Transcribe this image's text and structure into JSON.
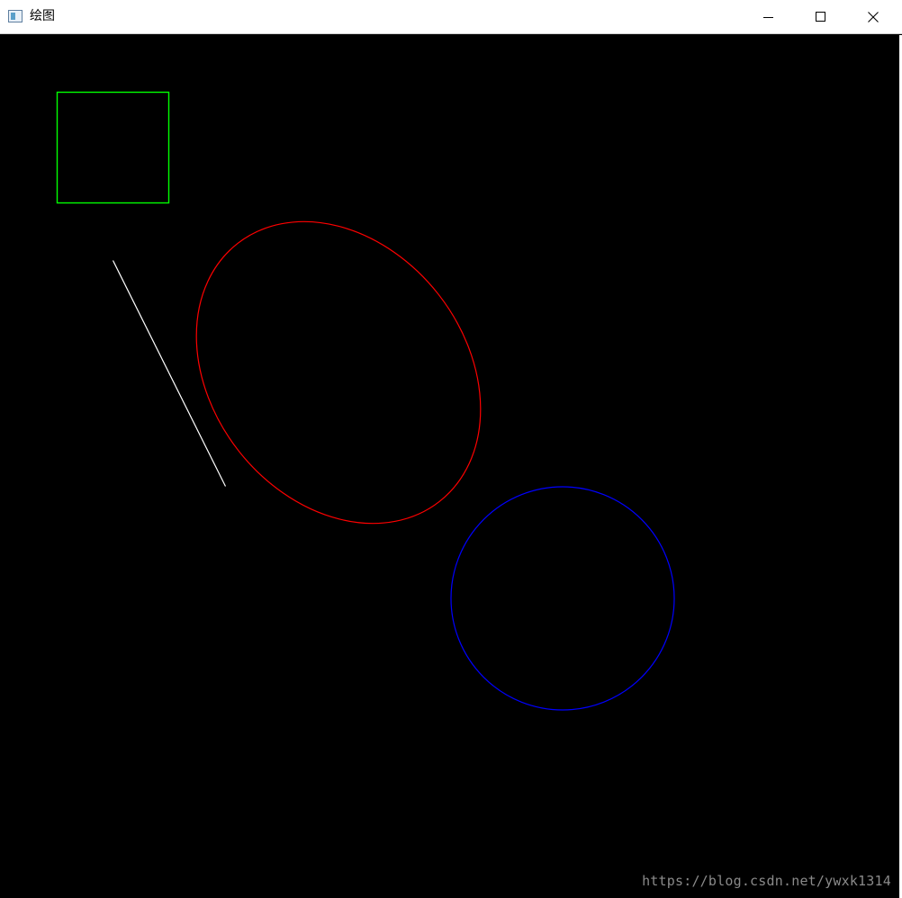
{
  "window": {
    "title": "绘图",
    "canvas_background": "#000000",
    "icons": {
      "app": "app-window-icon",
      "minimize": "minimize-icon",
      "maximize": "maximize-icon",
      "close": "close-icon"
    }
  },
  "shapes": {
    "rectangle": {
      "stroke": "#00ff00"
    },
    "line": {
      "stroke": "#ffffff"
    },
    "ellipse": {
      "stroke": "#ff0000"
    },
    "circle": {
      "stroke": "#0000ff"
    }
  },
  "watermark": {
    "text": "https://blog.csdn.net/ywxk1314"
  }
}
